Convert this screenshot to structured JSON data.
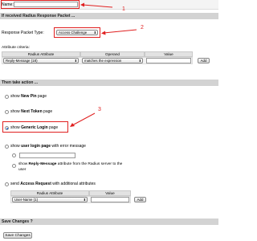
{
  "name_row": {
    "label": "Name:"
  },
  "section_received": {
    "title": "If received Radius Response Packet ..."
  },
  "packet_type": {
    "label": "Response Packet Type:",
    "value": "Access Challenge"
  },
  "attr_criteria": {
    "label": "Attribute criteria:",
    "columns": [
      "Radius Attribute",
      "Operand",
      "Value"
    ],
    "row": {
      "attribute": "Reply-Message (18)",
      "operand": "matches the expression",
      "value": ""
    },
    "add_label": "Add"
  },
  "section_action": {
    "title": "Then take action ..."
  },
  "actions": {
    "new_pin": {
      "prefix": "show ",
      "bold": "New Pin",
      "suffix": " page"
    },
    "next_token": {
      "prefix": "show ",
      "bold": "Next Token",
      "suffix": " page"
    },
    "generic_login": {
      "prefix": "show ",
      "bold": "Generic Login",
      "suffix": " page"
    },
    "user_login": {
      "prefix": "show ",
      "bold": "user login page",
      "suffix": " with error message"
    },
    "reply_message_line1": {
      "prefix": "show ",
      "bold": "Reply-Message",
      "suffix": " attribute from the Radius server to the"
    },
    "reply_message_line2": "user",
    "access_request": {
      "prefix": "send ",
      "bold": "Access Request",
      "suffix": " with additional attributes"
    }
  },
  "extra_attrs": {
    "columns": [
      "Radius Attribute",
      "Value"
    ],
    "row": {
      "attribute": "User-Name (1)",
      "value": ""
    },
    "add_label": "Add"
  },
  "section_save": {
    "title": "Save Changes ?"
  },
  "save_button": {
    "label": "Save Changes"
  },
  "callouts": {
    "one": "1",
    "two": "2",
    "three": "3"
  },
  "colors": {
    "header_bg": "#d3d3d3",
    "annotation": "#e02020",
    "selected_radio": "#2f6fd4"
  }
}
